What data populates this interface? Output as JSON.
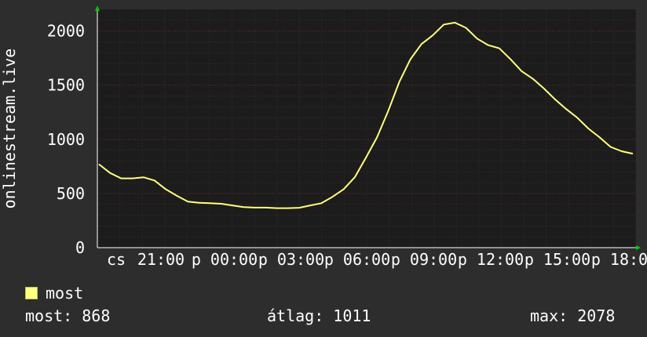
{
  "chart_data": {
    "type": "line",
    "title": "",
    "ylabel": "onlinestream.live",
    "xlabel": "",
    "ylim": [
      0,
      2200
    ],
    "yticks": [
      0,
      500,
      1000,
      1500,
      2000
    ],
    "grid": true,
    "x_tick_labels": [
      "cs",
      "21:00",
      "p 00:00",
      "p 03:00",
      "p 06:00",
      "p 09:00",
      "p 12:00",
      "p 15:00",
      "p 18:00"
    ],
    "x_unit": "hours since first sample (approx.)",
    "series": [
      {
        "name": "most",
        "color": "#ffff80",
        "x": [
          0,
          0.5,
          1,
          1.5,
          2,
          2.5,
          3,
          3.5,
          4,
          4.5,
          5,
          5.5,
          6,
          6.5,
          7,
          7.5,
          8,
          8.5,
          9,
          9.5,
          10,
          10.5,
          11,
          11.5,
          12,
          12.5,
          13,
          13.5,
          14,
          14.5,
          15,
          15.5,
          16,
          16.5,
          17,
          17.5,
          18,
          18.5,
          19,
          19.5,
          20,
          20.5,
          21,
          21.5,
          22,
          22.5,
          23,
          23.5,
          24
        ],
        "values": [
          770,
          690,
          640,
          640,
          650,
          620,
          540,
          480,
          425,
          415,
          410,
          405,
          390,
          375,
          370,
          370,
          365,
          365,
          368,
          390,
          410,
          470,
          540,
          650,
          830,
          1020,
          1260,
          1530,
          1740,
          1880,
          1960,
          2060,
          2078,
          2030,
          1930,
          1870,
          1840,
          1740,
          1630,
          1560,
          1470,
          1370,
          1280,
          1200,
          1100,
          1020,
          930,
          890,
          868
        ]
      }
    ]
  },
  "legend": {
    "label": "most"
  },
  "stats": {
    "now": "most: 868",
    "avg": "átlag: 1011",
    "max": "max: 2078"
  },
  "colors": {
    "background": "#2d2d2d",
    "plot_background": "#1c1c1c",
    "grid": "#5a2a2a",
    "line": "#ffff80",
    "axis": "#ffffff",
    "arrow": "#00cc00"
  }
}
